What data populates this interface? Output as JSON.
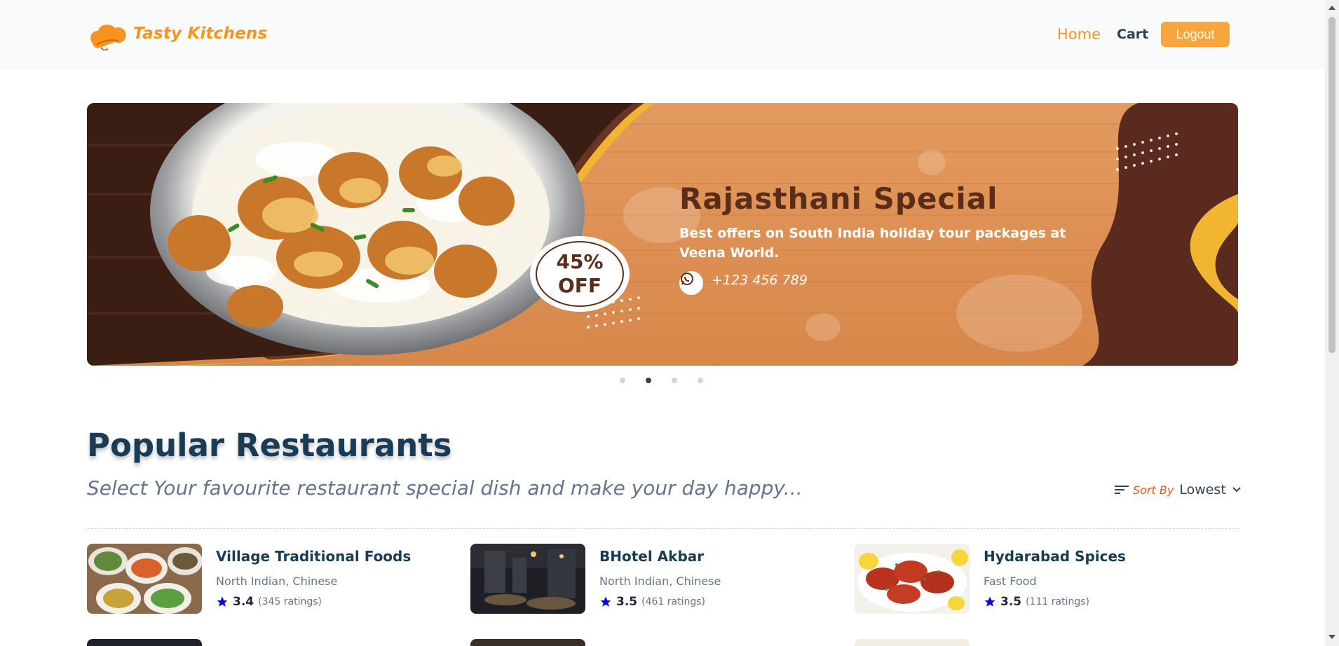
{
  "brand": {
    "name": "Tasty Kitchens",
    "color": "#f7931e"
  },
  "nav": {
    "home": "Home",
    "cart": "Cart",
    "logout": "Logout"
  },
  "banner": {
    "title": "Rajasthani Special",
    "subtitle": "Best offers on South India holiday tour packages at Veena World.",
    "phone": "+123 456 789",
    "offer_percent": "45%",
    "offer_label": "OFF",
    "slides_total": 4,
    "active_slide": 2
  },
  "section": {
    "title": "Popular Restaurants",
    "subtitle": "Select Your favourite restaurant special dish and make your day happy...",
    "sort_label": "Sort By",
    "sort_value": "Lowest"
  },
  "restaurants": [
    {
      "name": "Village Traditional Foods",
      "cuisine": "North Indian, Chinese",
      "rating": "3.4",
      "ratings_count": "(345 ratings)"
    },
    {
      "name": "BHotel Akbar",
      "cuisine": "North Indian, Chinese",
      "rating": "3.5",
      "ratings_count": "(461 ratings)"
    },
    {
      "name": "Hydarabad Spices",
      "cuisine": "Fast Food",
      "rating": "3.5",
      "ratings_count": "(111 ratings)"
    }
  ],
  "colors": {
    "accent": "#f7931e",
    "logout_bg": "#f7a53c",
    "heading": "#183b56",
    "sort_label": "#e9541e",
    "star": "#0000ee"
  }
}
